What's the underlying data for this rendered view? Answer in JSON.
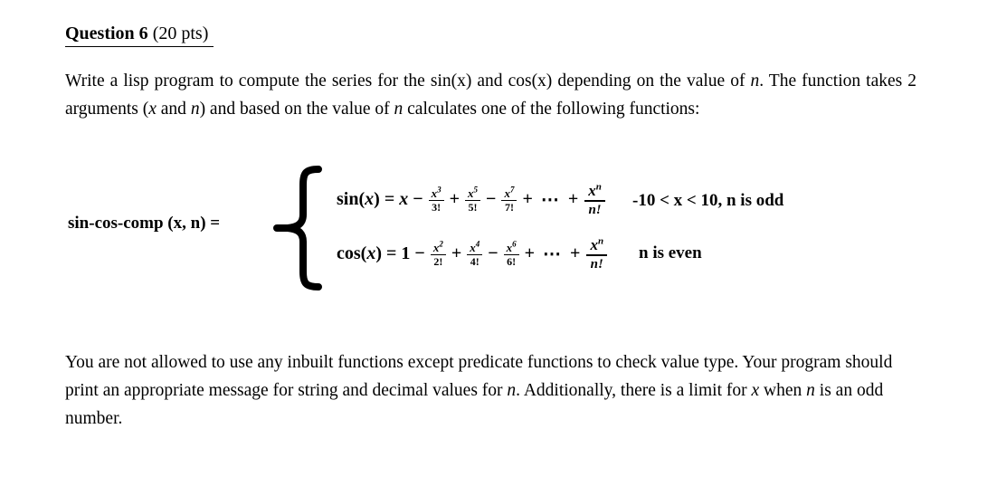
{
  "document": {
    "heading": {
      "question_title": "Question 6",
      "points": " (20 pts) "
    },
    "paragraph_1": {
      "segment_1": "Write a lisp program to compute the series for the sin(x) and cos(x) depending on the value of ",
      "var_n_1": "n",
      "segment_2": ". The function takes 2 arguments (",
      "var_x_1": "x",
      "segment_3": " and ",
      "var_n_2": "n",
      "segment_4": ") and based on the value of ",
      "var_n_3": "n",
      "segment_5": " calculates one of the following functions:"
    },
    "formula_block": {
      "function_label": "sin-cos-comp (x, n) =",
      "brace_icon": "left-curly-brace-icon",
      "sin_equation": {
        "name": "sin",
        "open_paren": "(",
        "argument": "x",
        "close_paren": ")",
        "equals": "=",
        "first_term": "x",
        "minus": "−",
        "plus": "+",
        "ellipsis": "⋯",
        "terms": [
          {
            "numerator": "x",
            "exponent": "3",
            "denominator": "3!"
          },
          {
            "numerator": "x",
            "exponent": "5",
            "denominator": "5!"
          },
          {
            "numerator": "x",
            "exponent": "7",
            "denominator": "7!"
          }
        ],
        "final_term": {
          "numerator": "x",
          "exponent": "n",
          "denominator": "n!"
        },
        "condition": "-10 < x < 10, n is odd"
      },
      "cos_equation": {
        "name": "cos",
        "open_paren": "(",
        "argument": "x",
        "close_paren": ")",
        "equals": "=",
        "first_term": "1",
        "minus": "−",
        "plus": "+",
        "ellipsis": "⋯",
        "terms": [
          {
            "numerator": "x",
            "exponent": "2",
            "denominator": "2!"
          },
          {
            "numerator": "x",
            "exponent": "4",
            "denominator": "4!"
          },
          {
            "numerator": "x",
            "exponent": "6",
            "denominator": "6!"
          }
        ],
        "final_term": {
          "numerator": "x",
          "exponent": "n",
          "denominator": "n!"
        },
        "condition": "n is even"
      }
    },
    "paragraph_2": {
      "segment_1": "You are not allowed to use any inbuilt functions except predicate functions to check value type. Your program should print an appropriate message for string and decimal values for ",
      "var_n_1": "n",
      "segment_2": ". Additionally, there is a limit for ",
      "var_x_1": "x",
      "segment_3": " when ",
      "var_n_2": "n",
      "segment_4": " is an odd number."
    }
  },
  "colors": {
    "text": "#000000",
    "background": "#ffffff"
  }
}
